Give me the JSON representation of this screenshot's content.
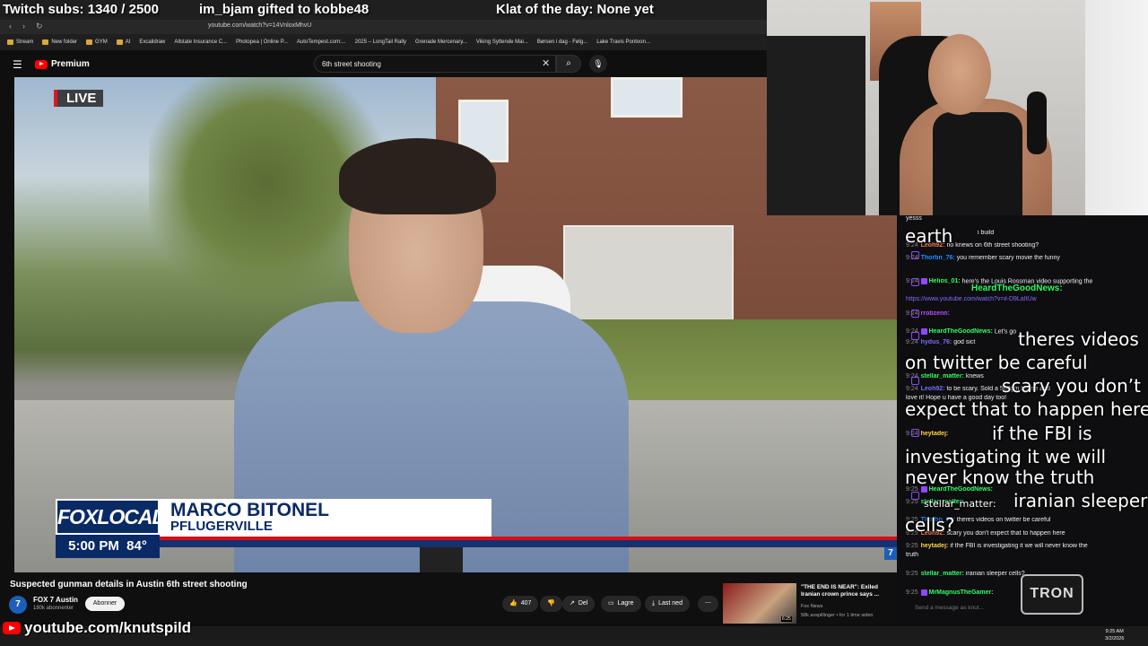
{
  "overlay": {
    "subs": "Twitch subs: 1340 / 2500",
    "gift": "im_bjam gifted to kobbe48",
    "klat": "Klat of the day: None yet",
    "yt_banner": "youtube.com/knutspild"
  },
  "browser": {
    "url": "youtube.com/watch?v=14VnloxMhvU",
    "bookmarks": [
      "Stream",
      "New folder",
      "GYM",
      "AI",
      "Excalidraw",
      "Allstate Insurance C...",
      "Photopea | Online P...",
      "AutoTempest.com:...",
      "2025 – LongTail Rally",
      "Grenade Mercenary...",
      "Viking Syttende Mai...",
      "Børsen i dag - Følg...",
      "Lake Travis Pontoon..."
    ]
  },
  "youtube": {
    "logo": "Premium",
    "search_value": "6th street shooting",
    "video_title": "Suspected gunman details in Austin 6th street shooting",
    "channel_name": "FOX 7 Austin",
    "channel_avatar": "7",
    "subscribers": "180k abonnenter",
    "subscribe_label": "Abonner",
    "likes": "407",
    "share_label": "Del",
    "save_label": "Lagre",
    "download_label": "Last ned"
  },
  "broadcast": {
    "live": "LIVE",
    "brand": "FOXLOCAL",
    "time": "5:00 PM",
    "temp": "84°",
    "name": "MARCO BITONEL",
    "location": "PFLUGERVILLE",
    "channel_bug": "7"
  },
  "recommended": {
    "title": "\"THE END IS NEAR\": Exiled Iranian crown prince says ...",
    "channel": "Fox News",
    "views": "58k avspillinger • for 1 time siden",
    "duration": "6:25"
  },
  "chat": {
    "lines": [
      {
        "ts": "",
        "user": "",
        "msg": "yesss"
      },
      {
        "ts": "",
        "user": "",
        "msg": "i build"
      },
      {
        "ts": "9:24",
        "user": "Leoh92:",
        "msg": "no knews on 6th street shooting?"
      },
      {
        "ts": "9:24",
        "user": "Thorbn_76:",
        "msg": "you remember scary movie the funny"
      },
      {
        "ts": "9:24",
        "user": "Helios_01:",
        "msg": "here's the Louis Rossman video supporting the"
      },
      {
        "ts": "",
        "user": "",
        "msg": "https://www.youtube.com/watch?v=il-D9LaItUw"
      },
      {
        "ts": "9:24",
        "user": "rrobzenn:",
        "msg": ""
      },
      {
        "ts": "9:24",
        "user": "HeardTheGoodNews:",
        "msg": "Let's go"
      },
      {
        "ts": "9:24",
        "user": "hydus_76:",
        "msg": "god sict"
      },
      {
        "ts": "9:24",
        "user": "stellar_matter:",
        "msg": "knews"
      },
      {
        "ts": "9:24",
        "user": "Leoh92:",
        "msg": "to be scary. Sold a 500gm house and"
      },
      {
        "ts": "",
        "user": "",
        "msg": "love it! Hope u have a good day too!"
      },
      {
        "ts": "9:24",
        "user": "heytadej:",
        "msg": ""
      },
      {
        "ts": "9:25",
        "user": "HeardTheGoodNews:",
        "msg": ""
      },
      {
        "ts": "9:25",
        "user": "stellar_matter:",
        "msg": ""
      },
      {
        "ts": "9:25",
        "user": "Thorbn_76:",
        "msg": "theres videos on twitter be careful"
      },
      {
        "ts": "9:25",
        "user": "Leoh92:",
        "msg": "scary you don't expect that to happen here"
      },
      {
        "ts": "9:25",
        "user": "heytadej:",
        "msg": "if the FBI is investigating it we will never know the"
      },
      {
        "ts": "",
        "user": "",
        "msg": "truth"
      },
      {
        "ts": "9:25",
        "user": "stellar_matter:",
        "msg": "iranian sleeper cells?"
      },
      {
        "ts": "9:25",
        "user": "MrMagnusTheGamer:",
        "msg": ""
      }
    ],
    "input_placeholder": "Send a message as knut...",
    "emote_text": "TRON"
  },
  "captions": {
    "c1": "earth",
    "c2": "theres videos",
    "c3": "on twitter be careful",
    "c4": "scary you don’t",
    "c5": "expect that to happen here",
    "c6": "if the FBI is",
    "c7": "investigating it we will",
    "c8": "never know the truth",
    "c9": "iranian sleeper",
    "c10": "cells?",
    "h1": "HeardTheGoodNews:",
    "h2": "stellar_matter:"
  },
  "taskbar": {
    "time": "9:25 AM",
    "date": "3/2/2026"
  }
}
